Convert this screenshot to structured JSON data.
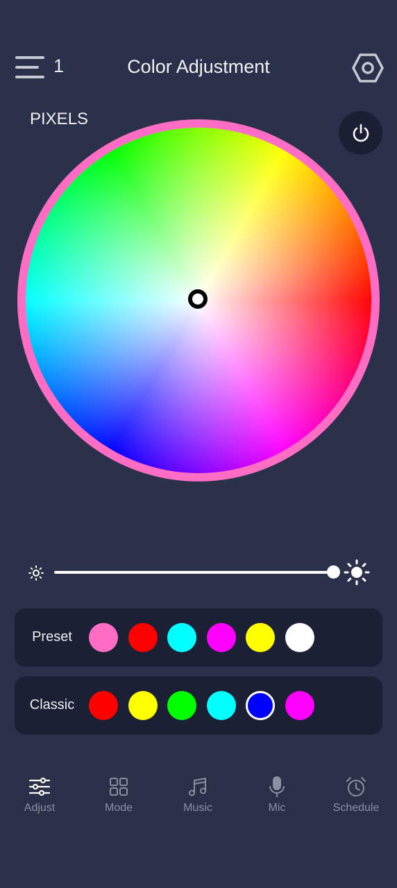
{
  "header": {
    "device_count": "1",
    "title": "Color Adjustment"
  },
  "wheel": {
    "label": "PIXELS",
    "ring_color": "#ff6ec4",
    "selected_color": "#ffffff"
  },
  "brightness": {
    "level_percent": 100
  },
  "preset": {
    "label": "Preset",
    "colors": [
      "#ff6ec4",
      "#ff0000",
      "#00ffff",
      "#ff00ff",
      "#ffff00",
      "#ffffff"
    ]
  },
  "classic": {
    "label": "Classic",
    "colors": [
      "#ff0000",
      "#ffff00",
      "#00ff00",
      "#00ffff",
      "#0000ff",
      "#ff00ff"
    ],
    "selected_index": 4
  },
  "nav": {
    "items": [
      {
        "label": "Adjust",
        "icon": "sliders-icon",
        "active": true
      },
      {
        "label": "Mode",
        "icon": "grid-icon",
        "active": false
      },
      {
        "label": "Music",
        "icon": "music-note-icon",
        "active": false
      },
      {
        "label": "Mic",
        "icon": "microphone-icon",
        "active": false
      },
      {
        "label": "Schedule",
        "icon": "alarm-clock-icon",
        "active": false
      }
    ]
  }
}
